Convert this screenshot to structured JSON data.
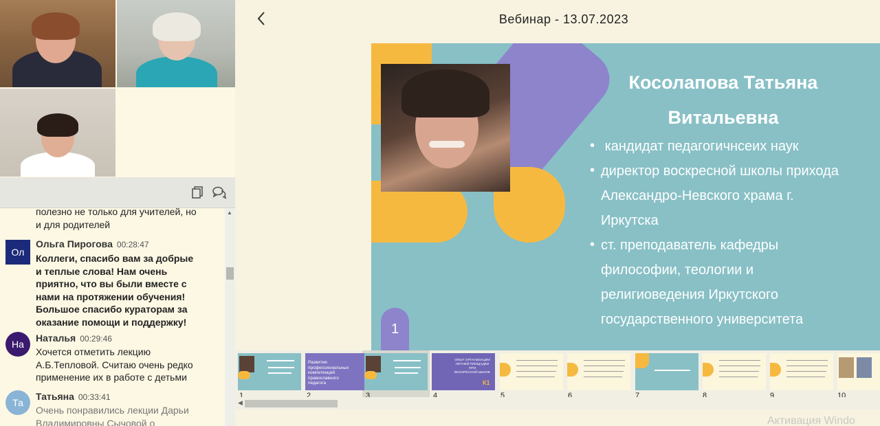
{
  "header": {
    "title": "Вебинар - 13.07.2023"
  },
  "chat": {
    "partial_text": [
      "полезно не только для учителей, но",
      "и для родителей"
    ],
    "messages": [
      {
        "initials": "Ол",
        "author": "Ольга Пирогова",
        "time": "00:28:47",
        "lines": [
          "Коллеги, спасибо вам за добрые",
          "и теплые слова! Нам очень",
          "приятно, что вы были вместе с",
          "нами на протяжении обучения!",
          "Большое спасибо кураторам за",
          "оказание помощи и поддержку!"
        ],
        "avatar_color": "#1b2a7a"
      },
      {
        "initials": "На",
        "author": "Наталья",
        "time": "00:29:46",
        "lines": [
          "Хочется отметить лекцию",
          "А.Б.Тепловой. Считаю очень редко",
          "применение их в работе с детьми"
        ],
        "avatar_color": "#3a1a6e"
      },
      {
        "initials": "Та",
        "author": "Татьяна",
        "time": "00:33:41",
        "lines": [
          "Очень понравились лекции Дарьи",
          "Владимировны Сычовой о"
        ],
        "avatar_color": "#8ab4d6"
      }
    ]
  },
  "slide": {
    "name_line1": "Косолапова Татьяна",
    "name_line2": "Витальевна",
    "bullets": [
      [
        "кандидат педагогичнсеих наук"
      ],
      [
        "директор воскресной школы прихода",
        "Александро-Невского храма г.",
        "Иркутска"
      ],
      [
        "ст. преподаватель кафедры",
        "философии, теологии и",
        "религиоведения Иркутского",
        "государственного университета"
      ]
    ],
    "number": "1",
    "colors": {
      "background": "#88c0c6",
      "yellow": "#f6b940",
      "purple": "#8d84cc"
    }
  },
  "thumbnails": {
    "numbers": [
      "1",
      "2",
      "3",
      "4",
      "5",
      "6",
      "7",
      "8",
      "9",
      "10"
    ],
    "selected": "3",
    "t2_text": [
      "Развитие",
      "профессиональных",
      "компетенций",
      "православного",
      "педагога"
    ],
    "t4_text": [
      "ОПЫТ ОРГАНИЗАЦИИ",
      "ЛЕТНЕЙ ПЛОЩАДКИ ПРИ",
      "ВОСКРЕСНОЙ ШКОЛЕ"
    ],
    "t4_brand": "К1"
  },
  "watermark": "Активация Windo"
}
